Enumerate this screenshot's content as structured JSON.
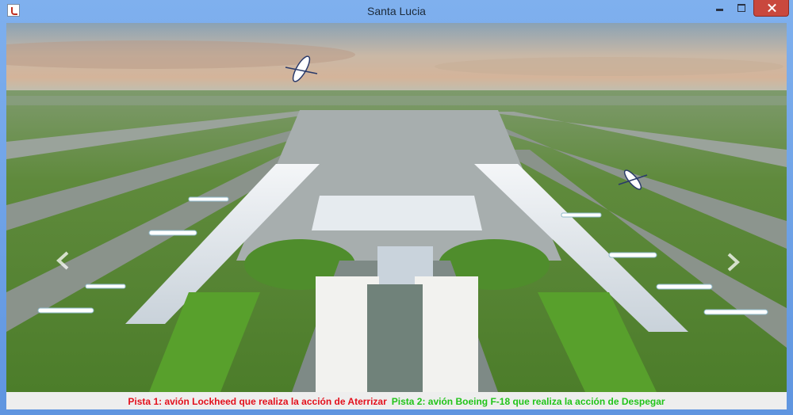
{
  "window": {
    "title": "Santa Lucia"
  },
  "status": {
    "runway1": "Pista 1: avión Lockheed que realiza la acción de Aterrizar",
    "runway2": "Pista 2: avión Boeing F-18 que realiza la acción de Despegar",
    "runway1_color": "#e3101c",
    "runway2_color": "#22c41a"
  },
  "icons": {
    "app": "java-icon",
    "prev": "chevron-left-icon",
    "next": "chevron-right-icon"
  }
}
